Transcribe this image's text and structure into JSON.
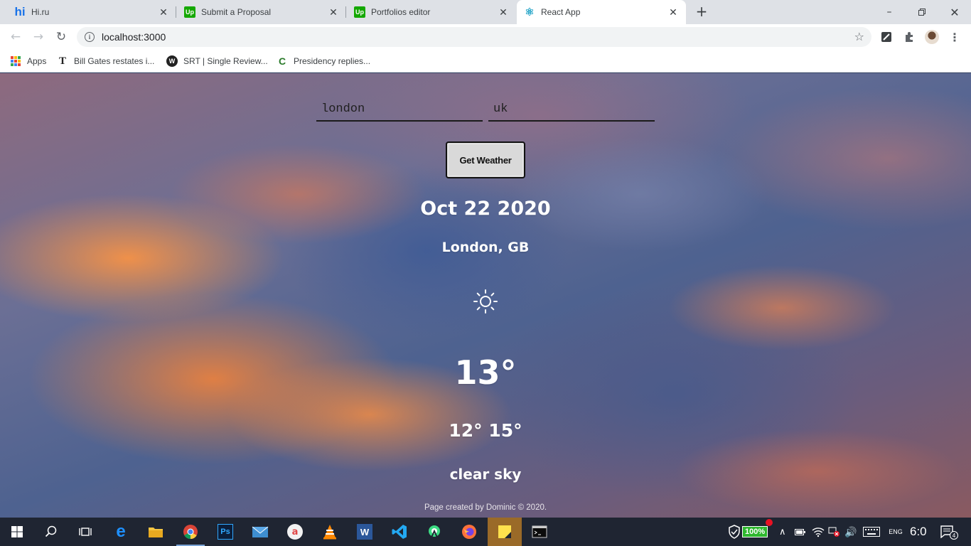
{
  "browser": {
    "tabs": [
      {
        "title": "Hi.ru",
        "favicon_text": "hi",
        "favicon_color": "#1a73e8"
      },
      {
        "title": "Submit a Proposal",
        "favicon_text": "Up",
        "favicon_color": "#14a800"
      },
      {
        "title": "Portfolios editor",
        "favicon_text": "Up",
        "favicon_color": "#14a800"
      },
      {
        "title": "React App",
        "favicon_text": "⚛",
        "favicon_color": "#61dafb"
      }
    ],
    "active_tab": 3,
    "url": "localhost:3000",
    "bookmarks": [
      {
        "label": "Apps"
      },
      {
        "label": "Bill Gates restates i..."
      },
      {
        "label": "SRT | Single Review..."
      },
      {
        "label": "Presidency replies..."
      }
    ]
  },
  "weather_app": {
    "city_value": "london",
    "country_value": "uk",
    "button_label": "Get Weather",
    "date": "Oct 22 2020",
    "location": "London, GB",
    "icon": "sun-icon",
    "temperature": "13°",
    "min_max": "12° 15°",
    "description": "clear sky",
    "footer": "Page created by Dominic © 2020."
  },
  "taskbar": {
    "battery": "100%",
    "clock": "6:0",
    "notification_count": "4",
    "lang": "ENG"
  },
  "colors": {
    "tabstrip_bg": "#dee1e6",
    "taskbar_bg": "#1f2532",
    "button_bg": "#d9d9d9",
    "battery_green": "#2eb82e"
  }
}
